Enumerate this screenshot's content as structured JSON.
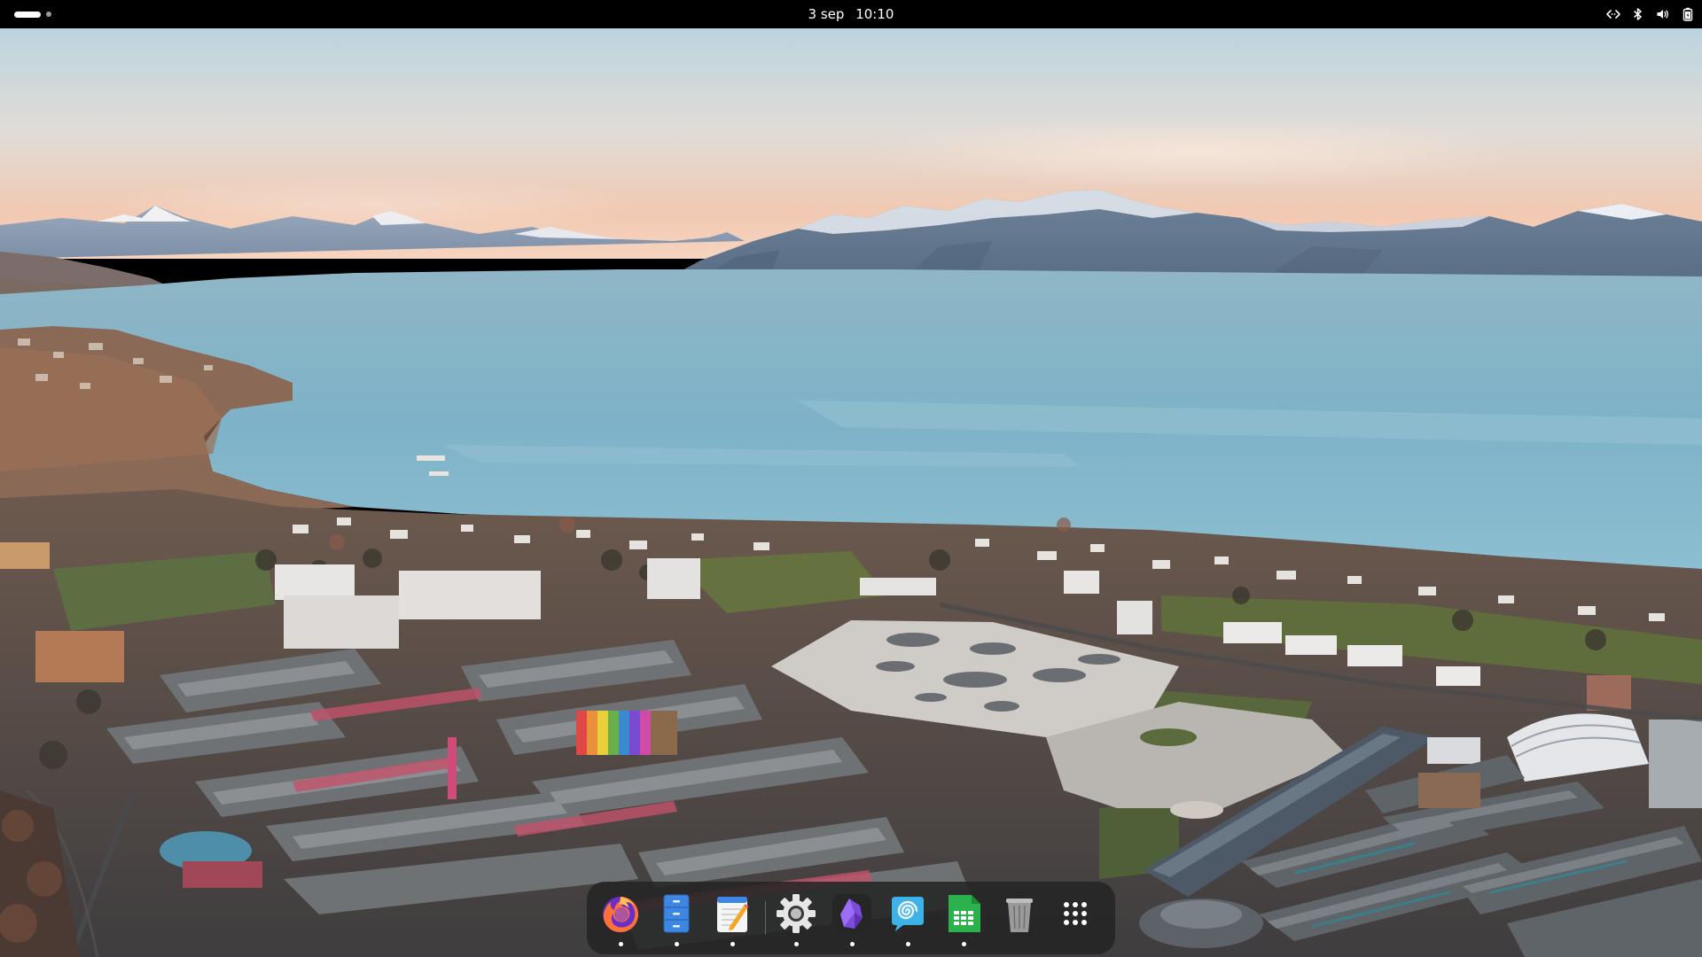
{
  "topbar": {
    "date": "3 sep",
    "time": "10:10",
    "workspaces": {
      "count": 2,
      "active": 1
    },
    "tray_icons": [
      "network-wired-icon",
      "bluetooth-icon",
      "volume-icon",
      "battery-icon"
    ]
  },
  "wallpaper": {
    "description_icon": "wallpaper-photo"
  },
  "dock": {
    "apps": [
      {
        "name": "firefox",
        "icon": "firefox-icon",
        "running": true
      },
      {
        "name": "files",
        "icon": "files-icon",
        "running": true
      },
      {
        "name": "text-editor",
        "icon": "text-editor-icon",
        "running": true
      },
      {
        "name": "settings",
        "icon": "gear-icon",
        "running": true
      },
      {
        "name": "obsidian",
        "icon": "obsidian-icon",
        "running": true
      },
      {
        "name": "budgie-welcome",
        "icon": "spiral-icon",
        "running": true
      },
      {
        "name": "spreadsheet",
        "icon": "spreadsheet-icon",
        "running": true
      },
      {
        "name": "trash",
        "icon": "trash-icon",
        "running": false
      },
      {
        "name": "show-applications",
        "icon": "app-grid-icon",
        "running": false
      }
    ]
  },
  "colors": {
    "topbar_bg": "#000000",
    "dock_bg": "#242424",
    "sky_top": "#c6dae4",
    "sky_horizon": "#f2c9b0",
    "lake": "#7fb3c8"
  }
}
